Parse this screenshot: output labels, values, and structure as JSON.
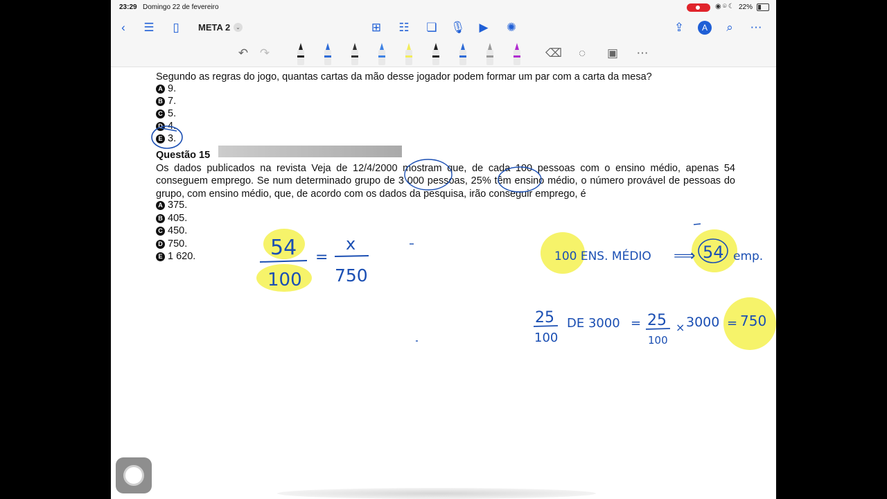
{
  "status_bar": {
    "time": "23:29",
    "date": "Domingo 22 de fevereiro",
    "battery": "22%"
  },
  "nav": {
    "title": "META 2"
  },
  "toolbar": {
    "pens": [
      {
        "name": "fountain-pen",
        "color": "#222222"
      },
      {
        "name": "blue-pen",
        "color": "#2e6bd6"
      },
      {
        "name": "black-marker",
        "color": "#333333"
      },
      {
        "name": "blue-fineliner",
        "color": "#3f82e3"
      },
      {
        "name": "yellow-highlighter",
        "color": "#f2ec5a"
      },
      {
        "name": "monoline-pen",
        "color": "#222222"
      },
      {
        "name": "dashed-pen",
        "color": "#2e6bd6"
      },
      {
        "name": "pencil",
        "color": "#999999"
      },
      {
        "name": "watercolor-brush",
        "color": "#b02bd0"
      }
    ]
  },
  "document": {
    "prev_question_text": "Segundo as regras do jogo, quantas cartas da mão desse jogador podem formar um par com a carta da mesa?",
    "prev_options": [
      {
        "letter": "A",
        "text": "9."
      },
      {
        "letter": "B",
        "text": "7."
      },
      {
        "letter": "C",
        "text": "5."
      },
      {
        "letter": "D",
        "text": "4."
      },
      {
        "letter": "E",
        "text": "3."
      }
    ],
    "question_title": "Questão 15",
    "question_text": "Os dados publicados na revista Veja de 12/4/2000 mostram que, de cada 100 pessoas com o ensino médio, apenas 54 conseguem emprego. Se num determinado grupo de 3 000 pessoas, 25% têm ensino médio, o número provável de pessoas do grupo, com ensino médio, que, de acordo com os dados da pesquisa, irão conseguir emprego, é",
    "options": [
      {
        "letter": "A",
        "text": "375."
      },
      {
        "letter": "B",
        "text": "405."
      },
      {
        "letter": "C",
        "text": "450."
      },
      {
        "letter": "D",
        "text": "750."
      },
      {
        "letter": "E",
        "text": "1 620."
      }
    ]
  },
  "handwriting": {
    "frac1_num": "54",
    "frac1_den": "100",
    "eq": "=",
    "frac2_num": "x",
    "frac2_den": "750",
    "rule_left": "100 ENS. MÉDIO",
    "rule_arrow": "⟹",
    "rule_num": "54",
    "rule_right": "emp.",
    "calc_frac_num": "25",
    "calc_frac_den": "100",
    "calc_de": "DE 3000",
    "calc_eq1": "=",
    "calc_frac2_num": "25",
    "calc_frac2_den": "100",
    "calc_times": "×",
    "calc_3000": "3000",
    "calc_eq2": "=",
    "calc_result": "750",
    "ink_color": "#1b4fb3",
    "highlight_color": "#f5f25a"
  }
}
